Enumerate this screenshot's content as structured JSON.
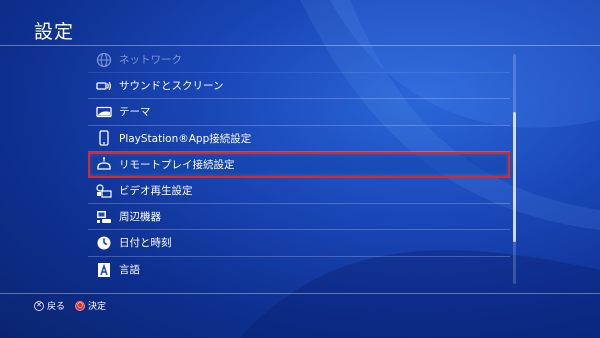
{
  "header": {
    "title": "設定"
  },
  "menu": {
    "items": [
      {
        "label": "ネットワーク",
        "icon": "globe-icon",
        "state": "faded"
      },
      {
        "label": "サウンドとスクリーン",
        "icon": "speaker-icon"
      },
      {
        "label": "テーマ",
        "icon": "theme-icon"
      },
      {
        "label": "PlayStation®App接続設定",
        "icon": "phone-icon"
      },
      {
        "label": "リモートプレイ接続設定",
        "icon": "remote-play-icon",
        "state": "selected"
      },
      {
        "label": "ビデオ再生設定",
        "icon": "video-icon"
      },
      {
        "label": "周辺機器",
        "icon": "devices-icon"
      },
      {
        "label": "日付と時刻",
        "icon": "clock-icon"
      },
      {
        "label": "言語",
        "icon": "language-icon"
      }
    ]
  },
  "footer": {
    "back_label": "戻る",
    "confirm_label": "決定"
  },
  "colors": {
    "selection_outline": "#d82a2a",
    "background": "#1a47b8"
  }
}
